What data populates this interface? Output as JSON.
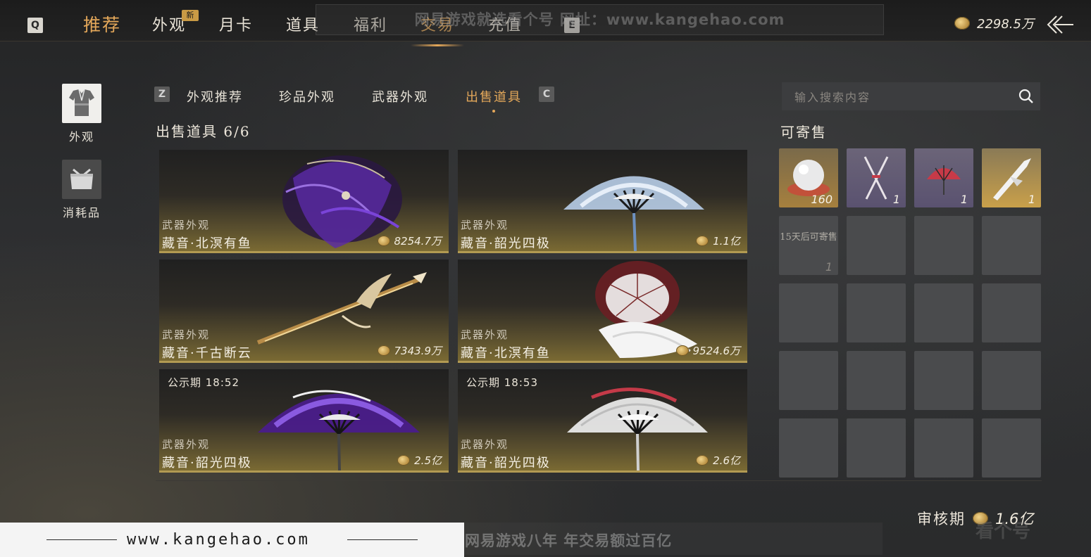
{
  "nav": {
    "key_left": "Q",
    "key_right": "E",
    "tabs": [
      {
        "label": "推荐"
      },
      {
        "label": "外观",
        "badge": "新"
      },
      {
        "label": "月卡"
      },
      {
        "label": "道具"
      },
      {
        "label": "福利"
      },
      {
        "label": "交易"
      },
      {
        "label": "充值"
      }
    ],
    "watermark": "网易游戏就选看个号  网址：www.kangehao.com",
    "currency_amount": "2298.5万"
  },
  "sidebar": {
    "items": [
      {
        "label": "外观",
        "icon": "robe-icon"
      },
      {
        "label": "消耗品",
        "icon": "package-icon"
      }
    ]
  },
  "subtabs": {
    "key_left": "Z",
    "key_right": "C",
    "items": [
      {
        "label": "外观推荐"
      },
      {
        "label": "珍品外观"
      },
      {
        "label": "武器外观"
      },
      {
        "label": "出售道具"
      }
    ]
  },
  "section_title": "出售道具 6/6",
  "cards": [
    {
      "category": "武器外观",
      "name": "藏音·北溟有鱼",
      "price": "8254.7万",
      "art": "purple-umbrella",
      "notice": ""
    },
    {
      "category": "武器外观",
      "name": "藏音·韶光四极",
      "price": "1.1亿",
      "art": "blue-fan",
      "notice": ""
    },
    {
      "category": "武器外观",
      "name": "藏音·千古断云",
      "price": "7343.9万",
      "art": "golden-spear",
      "notice": ""
    },
    {
      "category": "武器外观",
      "name": "藏音·北溟有鱼",
      "price": "9524.6万",
      "art": "red-white-umbrella",
      "notice": ""
    },
    {
      "category": "武器外观",
      "name": "藏音·韶光四极",
      "price": "2.5亿",
      "art": "purple-fan",
      "notice": "公示期 18:52"
    },
    {
      "category": "武器外观",
      "name": "藏音·韶光四极",
      "price": "2.6亿",
      "art": "red-white-fan",
      "notice": "公示期 18:53"
    }
  ],
  "search": {
    "placeholder": "输入搜索内容"
  },
  "consign": {
    "title": "可寄售",
    "slots": [
      {
        "qty": "160",
        "icon": "pearl-icon"
      },
      {
        "qty": "1",
        "icon": "crossed-swords-icon"
      },
      {
        "qty": "1",
        "icon": "red-fan-icon"
      },
      {
        "qty": "1",
        "icon": "white-blade-icon"
      }
    ],
    "locked_slot": {
      "text": "15天后可寄售",
      "qty": "1"
    }
  },
  "review": {
    "label": "审核期",
    "value": "1.6亿"
  },
  "footer_watermark": {
    "site": "www.kangehao.com",
    "slogan": "看个号专业网易游戏八年  年交易额过百亿",
    "logo": "看个号"
  },
  "colors": {
    "accent": "#e4a85a",
    "card_bottom": "#b29a52",
    "slot": "#4a4b4d"
  }
}
